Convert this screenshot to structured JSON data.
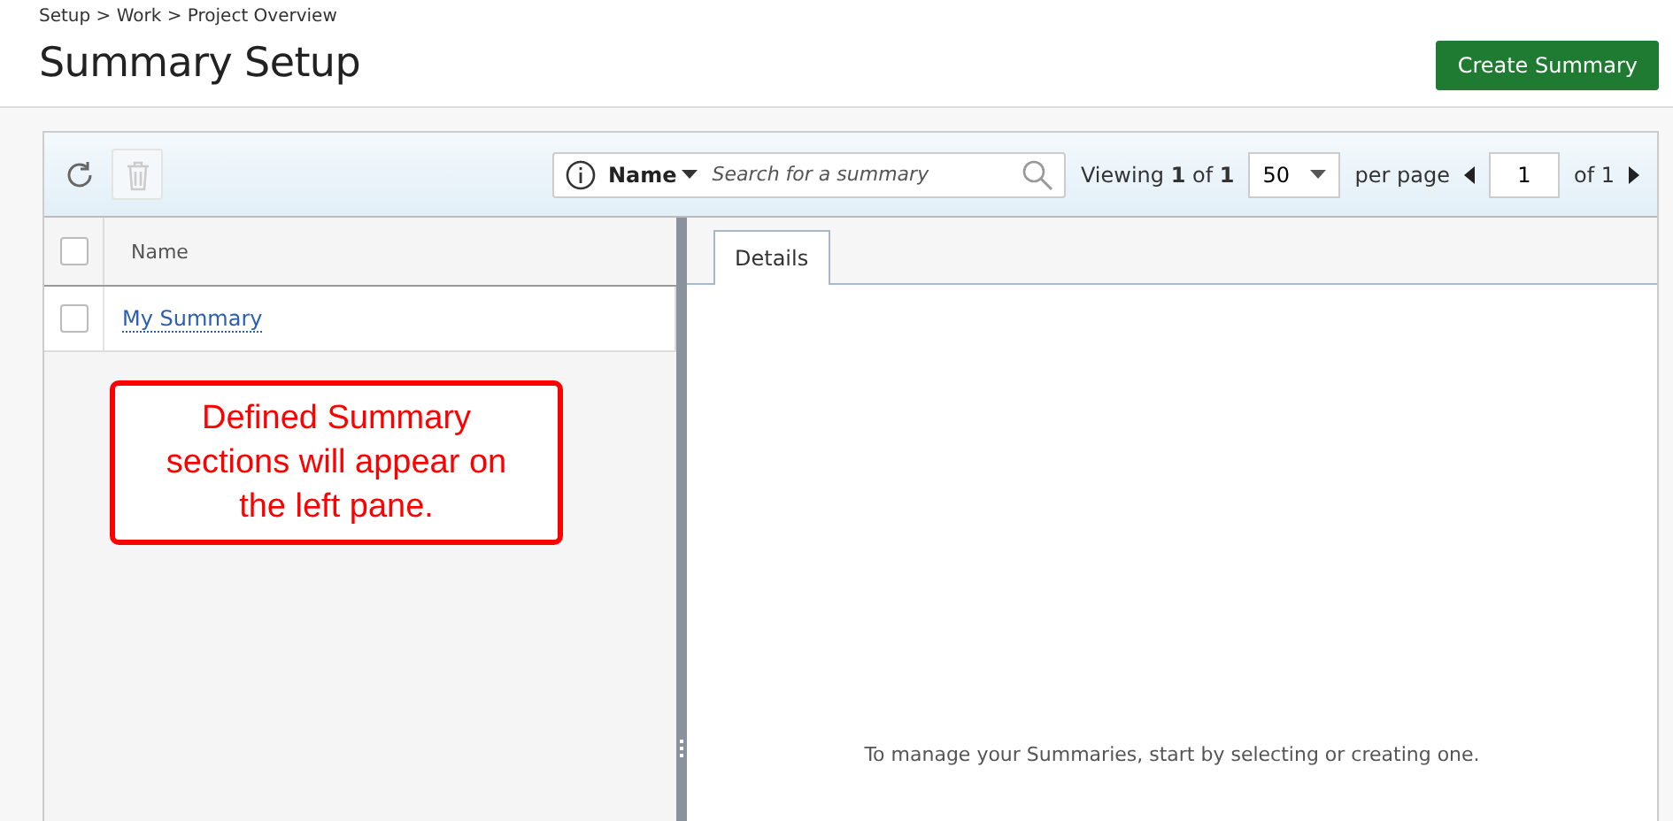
{
  "breadcrumb": "Setup > Work > Project Overview",
  "title": "Summary Setup",
  "create_button": "Create Summary",
  "toolbar": {
    "delete_disabled": true,
    "search": {
      "field": "Name",
      "placeholder": "Search for a summary"
    },
    "viewing": "Viewing **1** of **1**",
    "page_size": "50",
    "per_page": "per page",
    "page": "1",
    "of_pages": "of 1"
  },
  "list": {
    "header_checked": false,
    "column": "Name",
    "rows": [
      {
        "name": "My Summary",
        "checked": false
      }
    ]
  },
  "callout": "Defined Summary sections will appear on the left pane.",
  "tabs": [
    {
      "label": "Details",
      "selected": true
    }
  ],
  "empty_message": "To manage your Summaries, start by selecting or creating one."
}
